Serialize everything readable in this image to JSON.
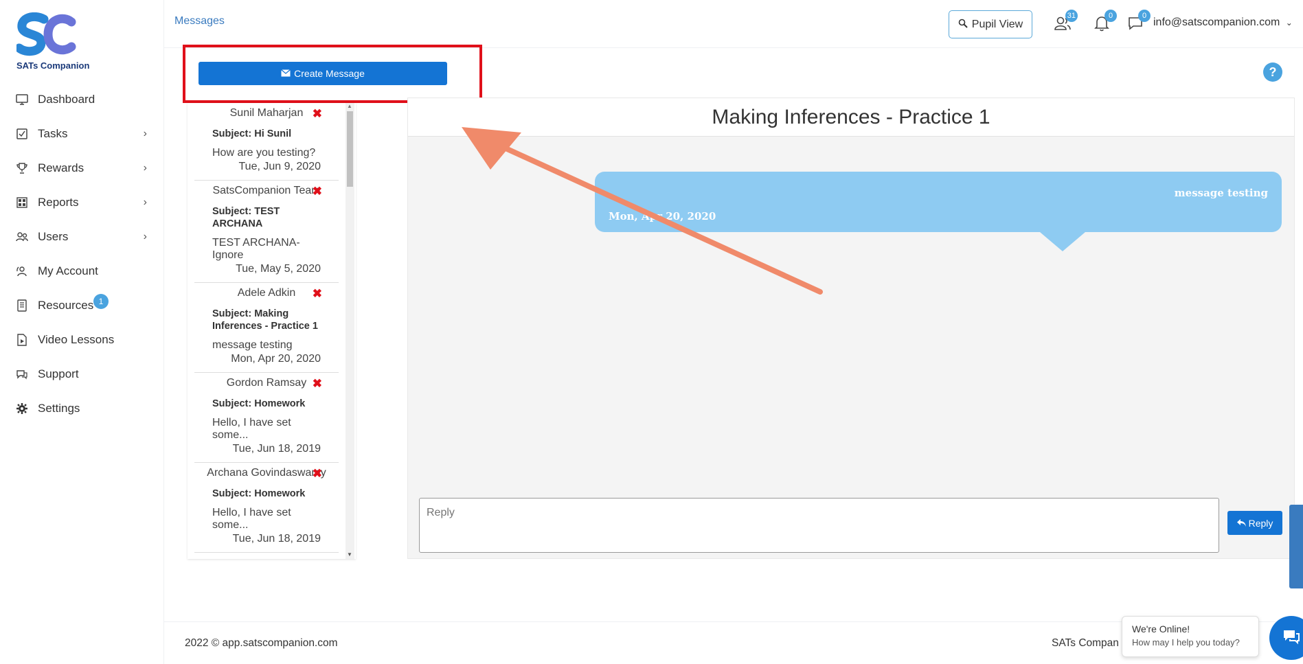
{
  "sidebar": {
    "logo_text": "SATs Companion",
    "items": [
      {
        "label": "Dashboard",
        "icon": "monitor-icon",
        "has_chevron": false
      },
      {
        "label": "Tasks",
        "icon": "tasks-icon",
        "has_chevron": true
      },
      {
        "label": "Rewards",
        "icon": "trophy-icon",
        "has_chevron": true
      },
      {
        "label": "Reports",
        "icon": "reports-icon",
        "has_chevron": true
      },
      {
        "label": "Users",
        "icon": "users-icon",
        "has_chevron": true
      },
      {
        "label": "My Account",
        "icon": "account-icon",
        "has_chevron": false
      },
      {
        "label": "Resources",
        "icon": "resources-icon",
        "has_chevron": false,
        "badge": "1"
      },
      {
        "label": "Video Lessons",
        "icon": "video-icon",
        "has_chevron": false
      },
      {
        "label": "Support",
        "icon": "support-icon",
        "has_chevron": false
      },
      {
        "label": "Settings",
        "icon": "gear-icon",
        "has_chevron": false
      }
    ]
  },
  "header": {
    "breadcrumb": "Messages",
    "pupil_view_label": "Pupil View",
    "users_count": "31",
    "notifications_count": "0",
    "messages_count": "0",
    "email": "info@satscompanion.com"
  },
  "actions": {
    "create_message_label": "Create Message"
  },
  "messages": [
    {
      "from": "Sunil Maharjan",
      "subject": "Subject: Hi Sunil",
      "body": "How are you testing?",
      "date": "Tue, Jun 9, 2020"
    },
    {
      "from": "SatsCompanion Team",
      "subject": "Subject: TEST ARCHANA",
      "body": "TEST ARCHANA-Ignore",
      "date": "Tue, May 5, 2020"
    },
    {
      "from": "Adele Adkin",
      "subject": "Subject: Making Inferences - Practice 1",
      "body": "message testing",
      "date": "Mon, Apr 20, 2020"
    },
    {
      "from": "Gordon Ramsay",
      "subject": "Subject: Homework",
      "body": "Hello, I have set some...",
      "date": "Tue, Jun 18, 2019"
    },
    {
      "from": "Archana Govindaswamy",
      "subject": "Subject: Homework",
      "body": "Hello, I have set some...",
      "date": "Tue, Jun 18, 2019"
    }
  ],
  "conversation": {
    "title": "Making Inferences - Practice 1",
    "bubble_text": "message testing",
    "bubble_date": "Mon, Apr 20, 2020",
    "reply_placeholder": "Reply",
    "reply_button_label": "Reply"
  },
  "footer": {
    "copyright": "2022 © app.satscompanion.com",
    "right_text": "SATs Compan"
  },
  "chat": {
    "line1": "We're Online!",
    "line2": "How may I help you today?"
  },
  "colors": {
    "primary": "#1474d4",
    "accent": "#4aa3df",
    "bubble": "#8ecbf2",
    "highlight": "#e0101a",
    "arrow": "#f08a6a"
  }
}
